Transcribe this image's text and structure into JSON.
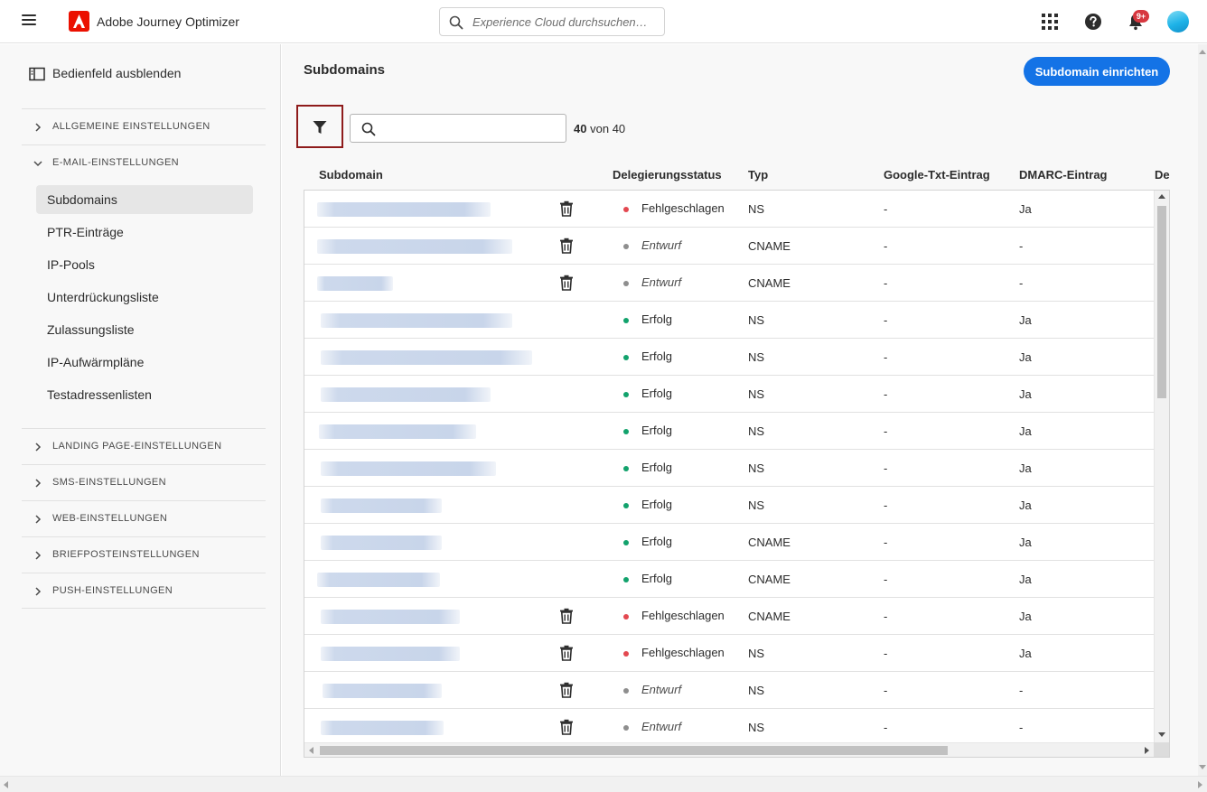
{
  "app": {
    "title": "Adobe Journey Optimizer",
    "brand_color": "#eb1000"
  },
  "topbar": {
    "search_placeholder": "Experience Cloud durchsuchen…",
    "notifications_badge": "9+",
    "icons": [
      "menu-icon",
      "apps-grid-icon",
      "help-icon",
      "bell-icon",
      "avatar"
    ]
  },
  "sidebar": {
    "collapse_label": "Bedienfeld ausblenden",
    "sections": [
      {
        "label": "ALLGEMEINE EINSTELLUNGEN",
        "expanded": false
      },
      {
        "label": "E-MAIL-EINSTELLUNGEN",
        "expanded": true
      },
      {
        "label": "LANDING PAGE-EINSTELLUNGEN",
        "expanded": false
      },
      {
        "label": "SMS-EINSTELLUNGEN",
        "expanded": false
      },
      {
        "label": "WEB-EINSTELLUNGEN",
        "expanded": false
      },
      {
        "label": "BRIEFPOSTEINSTELLUNGEN",
        "expanded": false
      },
      {
        "label": "PUSH-EINSTELLUNGEN",
        "expanded": false
      }
    ],
    "email_items": [
      {
        "label": "Subdomains",
        "active": true
      },
      {
        "label": "PTR-Einträge",
        "active": false
      },
      {
        "label": "IP-Pools",
        "active": false
      },
      {
        "label": "Unterdrückungsliste",
        "active": false
      },
      {
        "label": "Zulassungsliste",
        "active": false
      },
      {
        "label": "IP-Aufwärmpläne",
        "active": false
      },
      {
        "label": "Testadressenlisten",
        "active": false
      }
    ]
  },
  "main": {
    "title": "Subdomains",
    "cta_label": "Subdomain einrichten",
    "accent_color": "#1473e6",
    "count": {
      "shown": "40",
      "sep": "von",
      "total": "40"
    },
    "columns": [
      "Subdomain",
      "Delegierungsstatus",
      "Typ",
      "Google-Txt-Eintrag",
      "DMARC-Eintrag",
      "De"
    ],
    "status_colors": {
      "Fehlgeschlagen": "#e34850",
      "Entwurf": "#8e8e8e",
      "Erfolg": "#12a26c"
    },
    "rows": [
      {
        "status": "Fehlgeschlagen",
        "type": "NS",
        "google": "-",
        "dmarc": "Ja",
        "deletable": true
      },
      {
        "status": "Entwurf",
        "type": "CNAME",
        "google": "-",
        "dmarc": "-",
        "deletable": true
      },
      {
        "status": "Entwurf",
        "type": "CNAME",
        "google": "-",
        "dmarc": "-",
        "deletable": true
      },
      {
        "status": "Erfolg",
        "type": "NS",
        "google": "-",
        "dmarc": "Ja",
        "deletable": false
      },
      {
        "status": "Erfolg",
        "type": "NS",
        "google": "-",
        "dmarc": "Ja",
        "deletable": false
      },
      {
        "status": "Erfolg",
        "type": "NS",
        "google": "-",
        "dmarc": "Ja",
        "deletable": false
      },
      {
        "status": "Erfolg",
        "type": "NS",
        "google": "-",
        "dmarc": "Ja",
        "deletable": false
      },
      {
        "status": "Erfolg",
        "type": "NS",
        "google": "-",
        "dmarc": "Ja",
        "deletable": false
      },
      {
        "status": "Erfolg",
        "type": "NS",
        "google": "-",
        "dmarc": "Ja",
        "deletable": false
      },
      {
        "status": "Erfolg",
        "type": "CNAME",
        "google": "-",
        "dmarc": "Ja",
        "deletable": false
      },
      {
        "status": "Erfolg",
        "type": "CNAME",
        "google": "-",
        "dmarc": "Ja",
        "deletable": false
      },
      {
        "status": "Fehlgeschlagen",
        "type": "CNAME",
        "google": "-",
        "dmarc": "Ja",
        "deletable": true
      },
      {
        "status": "Fehlgeschlagen",
        "type": "NS",
        "google": "-",
        "dmarc": "Ja",
        "deletable": true
      },
      {
        "status": "Entwurf",
        "type": "NS",
        "google": "-",
        "dmarc": "-",
        "deletable": true
      },
      {
        "status": "Entwurf",
        "type": "NS",
        "google": "-",
        "dmarc": "-",
        "deletable": true
      }
    ]
  }
}
